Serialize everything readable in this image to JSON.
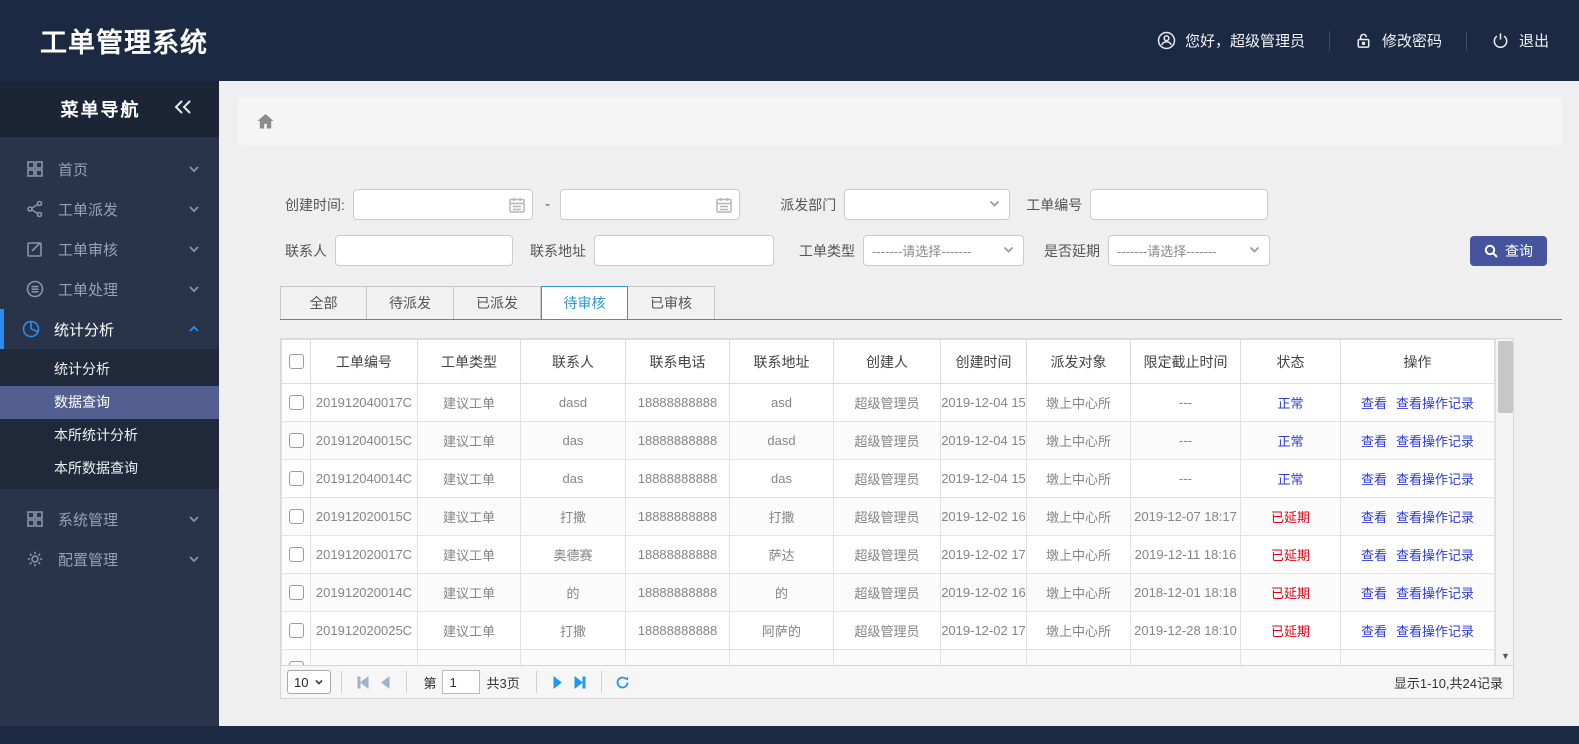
{
  "header": {
    "title": "工单管理系统",
    "greeting": "您好，超级管理员",
    "change_password": "修改密码",
    "logout": "退出"
  },
  "sidebar": {
    "title": "菜单导航",
    "items": [
      {
        "label": "首页",
        "icon": "grid-icon"
      },
      {
        "label": "工单派发",
        "icon": "share-icon"
      },
      {
        "label": "工单审核",
        "icon": "edit-icon"
      },
      {
        "label": "工单处理",
        "icon": "process-icon"
      },
      {
        "label": "统计分析",
        "icon": "pie-chart-icon",
        "expanded": true
      },
      {
        "label": "系统管理",
        "icon": "grid-icon"
      },
      {
        "label": "配置管理",
        "icon": "gear-icon"
      }
    ],
    "submenu": [
      {
        "label": "统计分析",
        "active": false
      },
      {
        "label": "数据查询",
        "active": true
      },
      {
        "label": "本所统计分析",
        "active": false
      },
      {
        "label": "本所数据查询",
        "active": false
      }
    ]
  },
  "filters": {
    "create_time_label": "创建时间:",
    "date_separator": "-",
    "dispatch_dept_label": "派发部门",
    "order_no_label": "工单编号",
    "contact_label": "联系人",
    "address_label": "联系地址",
    "order_type_label": "工单类型",
    "delay_label": "是否延期",
    "select_placeholder": "-------请选择-------",
    "search_button": "查询"
  },
  "tabs": [
    {
      "label": "全部",
      "active": false
    },
    {
      "label": "待派发",
      "active": false
    },
    {
      "label": "已派发",
      "active": false
    },
    {
      "label": "待审核",
      "active": true
    },
    {
      "label": "已审核",
      "active": false
    }
  ],
  "table": {
    "columns": [
      "工单编号",
      "工单类型",
      "联系人",
      "联系电话",
      "联系地址",
      "创建人",
      "创建时间",
      "派发对象",
      "限定截止时间",
      "状态",
      "操作"
    ],
    "action_labels": [
      "查看",
      "查看操作记录"
    ],
    "rows": [
      {
        "order_no": "201912040017C",
        "order_type": "建议工单",
        "contact": "dasd",
        "phone": "18888888888",
        "address": "asd",
        "creator": "超级管理员",
        "create_time": "2019-12-04 15",
        "dispatch_target": "墩上中心所",
        "deadline": "---",
        "status": "正常",
        "status_kind": "normal"
      },
      {
        "order_no": "201912040015C",
        "order_type": "建议工单",
        "contact": "das",
        "phone": "18888888888",
        "address": "dasd",
        "creator": "超级管理员",
        "create_time": "2019-12-04 15",
        "dispatch_target": "墩上中心所",
        "deadline": "---",
        "status": "正常",
        "status_kind": "normal"
      },
      {
        "order_no": "201912040014C",
        "order_type": "建议工单",
        "contact": "das",
        "phone": "18888888888",
        "address": "das",
        "creator": "超级管理员",
        "create_time": "2019-12-04 15",
        "dispatch_target": "墩上中心所",
        "deadline": "---",
        "status": "正常",
        "status_kind": "normal"
      },
      {
        "order_no": "201912020015C",
        "order_type": "建议工单",
        "contact": "打撒",
        "phone": "18888888888",
        "address": "打撒",
        "creator": "超级管理员",
        "create_time": "2019-12-02 16",
        "dispatch_target": "墩上中心所",
        "deadline": "2019-12-07 18:17",
        "status": "已延期",
        "status_kind": "delay"
      },
      {
        "order_no": "201912020017C",
        "order_type": "建议工单",
        "contact": "奥德赛",
        "phone": "18888888888",
        "address": "萨达",
        "creator": "超级管理员",
        "create_time": "2019-12-02 17",
        "dispatch_target": "墩上中心所",
        "deadline": "2019-12-11 18:16",
        "status": "已延期",
        "status_kind": "delay"
      },
      {
        "order_no": "201912020014C",
        "order_type": "建议工单",
        "contact": "的",
        "phone": "18888888888",
        "address": "的",
        "creator": "超级管理员",
        "create_time": "2019-12-02 16",
        "dispatch_target": "墩上中心所",
        "deadline": "2018-12-01 18:18",
        "status": "已延期",
        "status_kind": "delay"
      },
      {
        "order_no": "201912020025C",
        "order_type": "建议工单",
        "contact": "打撒",
        "phone": "18888888888",
        "address": "阿萨的",
        "creator": "超级管理员",
        "create_time": "2019-12-02 17",
        "dispatch_target": "墩上中心所",
        "deadline": "2019-12-28 18:10",
        "status": "已延期",
        "status_kind": "delay"
      },
      {
        "order_no": "",
        "order_type": "",
        "contact": "",
        "phone": "",
        "address": "",
        "creator": "",
        "create_time": "",
        "dispatch_target": "",
        "deadline": "",
        "status": "",
        "status_kind": "partial"
      }
    ]
  },
  "pagination": {
    "page_size": "10",
    "page_prefix": "第",
    "current_page": "1",
    "total_pages": "共3页",
    "summary": "显示1-10,共24记录"
  },
  "colors": {
    "header_navy": "#1b2a42",
    "sidebar_bg": "#29334a",
    "accent_blue": "#2d8cf0",
    "submenu_active": "#525f90",
    "tab_active_blue": "#2e97d6",
    "button_indigo": "#45549c",
    "link_blue": "#2b3cd8",
    "status_red": "#e60012"
  }
}
